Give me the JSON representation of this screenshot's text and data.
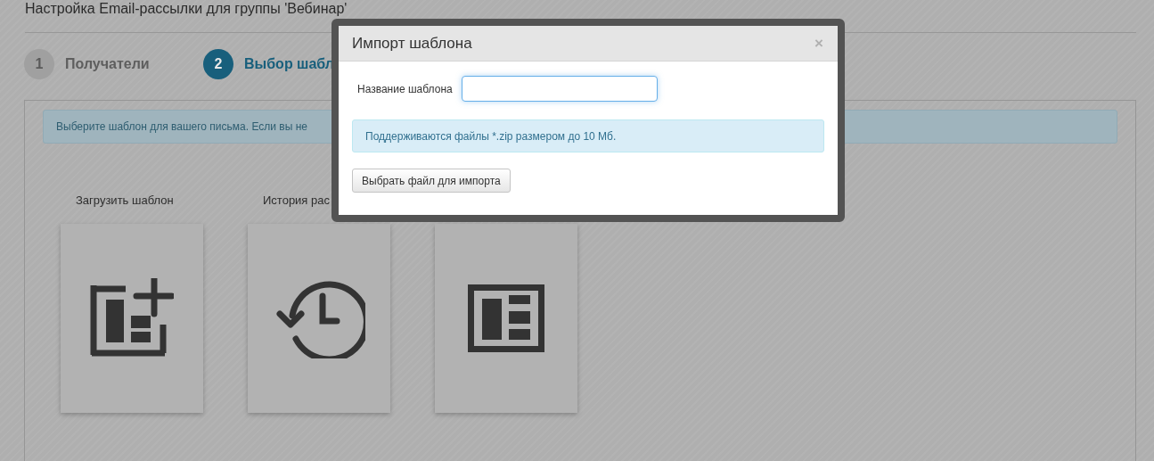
{
  "page": {
    "title": "Настройка Email-рассылки для группы 'Вебинар'",
    "steps": [
      {
        "number": "1",
        "label": "Получатели",
        "selected": false
      },
      {
        "number": "2",
        "label": "Выбор шабл",
        "selected": true
      }
    ],
    "notice": "Выберите шаблон для вашего письма. Если вы не",
    "tiles": [
      {
        "label": "Загрузить шаблон",
        "kind": "upload"
      },
      {
        "label": "История рас",
        "kind": "history"
      },
      {
        "kind": "template"
      }
    ]
  },
  "dialog": {
    "title": "Импорт шаблона",
    "close": "×",
    "field_label": "Название шаблона",
    "notice": "Поддерживаются файлы *.zip размером до 10 Мб.",
    "button": "Выбрать файл для импорта"
  }
}
